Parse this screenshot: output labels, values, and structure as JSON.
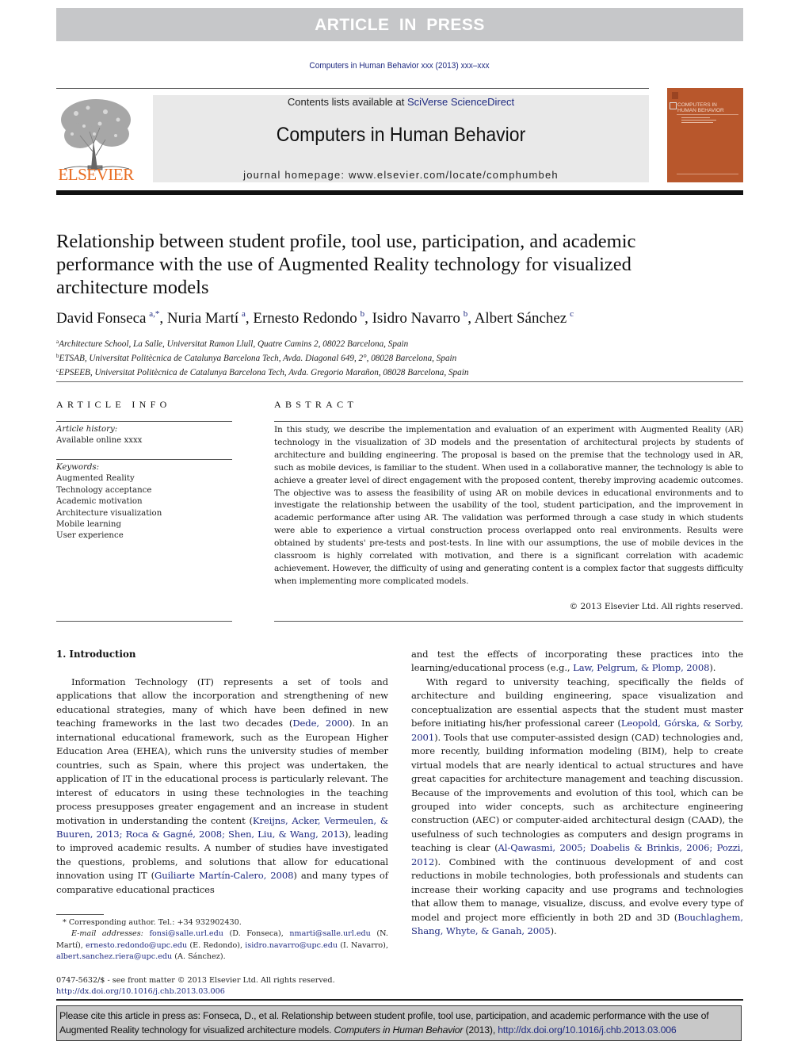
{
  "banner": {
    "text": "ARTICLE IN PRESS"
  },
  "journal_ref": "Computers in Human Behavior xxx (2013) xxx–xxx",
  "header": {
    "contents_prefix": "Contents lists available at ",
    "contents_link": "SciVerse ScienceDirect",
    "journal_title": "Computers in Human Behavior",
    "homepage_prefix": "journal homepage: ",
    "homepage_url": "www.elsevier.com/locate/comphumbeh",
    "publisher_logo_text": "ELSEVIER",
    "cover_title_line1": "COMPUTERS IN",
    "cover_title_line2": "HUMAN BEHAVIOR",
    "colors": {
      "publisher_orange": "#e86b1f",
      "cover": "#b8572c",
      "link": "#1f2a80",
      "banner": "#c6c7c9"
    }
  },
  "article": {
    "title": "Relationship between student profile, tool use, participation, and academic performance with the use of Augmented Reality technology for visualized architecture models",
    "authors": [
      {
        "name": "David Fonseca",
        "aff": "a,*"
      },
      {
        "name": "Nuria Martí",
        "aff": "a"
      },
      {
        "name": "Ernesto Redondo",
        "aff": "b"
      },
      {
        "name": "Isidro Navarro",
        "aff": "b"
      },
      {
        "name": "Albert Sánchez",
        "aff": "c"
      }
    ],
    "affiliations": [
      {
        "key": "a",
        "text": "Architecture School, La Salle, Universitat Ramon Llull, Quatre Camins 2, 08022 Barcelona, Spain"
      },
      {
        "key": "b",
        "text": "ETSAB, Universitat Politècnica de Catalunya Barcelona Tech, Avda. Diagonal 649, 2°, 08028 Barcelona, Spain"
      },
      {
        "key": "c",
        "text": "EPSEEB, Universitat Politècnica de Catalunya Barcelona Tech, Avda. Gregorio Marañon, 08028 Barcelona, Spain"
      }
    ]
  },
  "article_info": {
    "heading": "ARTICLE INFO",
    "history_label": "Article history:",
    "history_value": "Available online xxxx",
    "keywords_label": "Keywords:",
    "keywords": [
      "Augmented Reality",
      "Technology acceptance",
      "Academic motivation",
      "Architecture visualization",
      "Mobile learning",
      "User experience"
    ]
  },
  "abstract": {
    "heading": "ABSTRACT",
    "text": "In this study, we describe the implementation and evaluation of an experiment with Augmented Reality (AR) technology in the visualization of 3D models and the presentation of architectural projects by students of architecture and building engineering. The proposal is based on the premise that the technology used in AR, such as mobile devices, is familiar to the student. When used in a collaborative manner, the technology is able to achieve a greater level of direct engagement with the proposed content, thereby improving academic outcomes. The objective was to assess the feasibility of using AR on mobile devices in educational environments and to investigate the relationship between the usability of the tool, student participation, and the improvement in academic performance after using AR. The validation was performed through a case study in which students were able to experience a virtual construction process overlapped onto real environments. Results were obtained by students' pre-tests and post-tests. In line with our assumptions, the use of mobile devices in the classroom is highly correlated with motivation, and there is a significant correlation with academic achievement. However, the difficulty of using and generating content is a complex factor that suggests difficulty when implementing more complicated models.",
    "copyright": "© 2013 Elsevier Ltd. All rights reserved."
  },
  "introduction": {
    "heading": "1. Introduction",
    "left_column": [
      {
        "t": "Information Technology (IT) represents a set of tools and applications that allow the incorporation and strengthening of new educational strategies, many of which have been defined in new teaching frameworks in the last two decades ("
      },
      {
        "link": "Dede, 2000"
      },
      {
        "t": "). In an international educational framework, such as the European Higher Education Area (EHEA), which runs the university studies of member countries, such as Spain, where this project was undertaken, the application of IT in the educational process is particularly relevant. The interest of educators in using these technologies in the teaching process presupposes greater engagement and an increase in student motivation in understanding the content ("
      },
      {
        "link": "Kreijns, Acker, Vermeulen, & Buuren, 2013; Roca & Gagné, 2008; Shen, Liu, & Wang, 2013"
      },
      {
        "t": "), leading to improved academic results. A number of studies have investigated the questions, problems, and solutions that allow for educational innovation using IT ("
      },
      {
        "link": "Guiliarte Martín-Calero, 2008"
      },
      {
        "t": ") and many types of comparative educational practices"
      }
    ],
    "right_column_p1": [
      {
        "t": "and test the effects of incorporating these practices into the learning/educational process (e.g., "
      },
      {
        "link": "Law, Pelgrum, & Plomp, 2008"
      },
      {
        "t": ")."
      }
    ],
    "right_column_p2": [
      {
        "t": "With regard to university teaching, specifically the fields of architecture and building engineering, space visualization and conceptualization are essential aspects that the student must master before initiating his/her professional career ("
      },
      {
        "link": "Leopold, Górska, & Sorby, 2001"
      },
      {
        "t": "). Tools that use computer-assisted design (CAD) technologies and, more recently, building information modeling (BIM), help to create virtual models that are nearly identical to actual structures and have great capacities for architecture management and teaching discussion. Because of the improvements and evolution of this tool, which can be grouped into wider concepts, such as architecture engineering construction (AEC) or computer-aided architectural design (CAAD), the usefulness of such technologies as computers and design programs in teaching is clear ("
      },
      {
        "link": "Al-Qawasmi, 2005; Doabelis & Brinkis, 2006; Pozzi, 2012"
      },
      {
        "t": "). Combined with the continuous development of and cost reductions in mobile technologies, both professionals and students can increase their working capacity and use programs and technologies that allow them to manage, visualize, discuss, and evolve every type of model and project more efficiently in both 2D and 3D ("
      },
      {
        "link": "Bouchlaghem, Shang, Whyte, & Ganah, 2005"
      },
      {
        "t": ")."
      }
    ]
  },
  "footnotes": {
    "corresponding": "* Corresponding author. Tel.: +34 932902430.",
    "email_label": "E-mail addresses:",
    "emails": [
      {
        "email": "fonsi@salle.url.edu",
        "who": "(D. Fonseca)"
      },
      {
        "email": "nmarti@salle.url.edu",
        "who": "(N. Martí)"
      },
      {
        "email": "ernesto.redondo@upc.edu",
        "who": "(E. Redondo)"
      },
      {
        "email": "isidro.navarro@upc.edu",
        "who": "(I. Navarro)"
      },
      {
        "email": "albert.sanchez.riera@upc.edu",
        "who": "(A. Sánchez)."
      }
    ],
    "front_matter": "0747-5632/$ - see front matter © 2013 Elsevier Ltd. All rights reserved.",
    "doi": "http://dx.doi.org/10.1016/j.chb.2013.03.006"
  },
  "citation_box": {
    "prefix": "Please cite this article in press as: Fonseca, D., et al. Relationship between student profile, tool use, participation, and academic performance with the use of Augmented Reality technology for visualized architecture models. ",
    "journal": "Computers in Human Behavior",
    "year": " (2013), ",
    "doi": "http://dx.doi.org/10.1016/j.chb.2013.03.006"
  }
}
